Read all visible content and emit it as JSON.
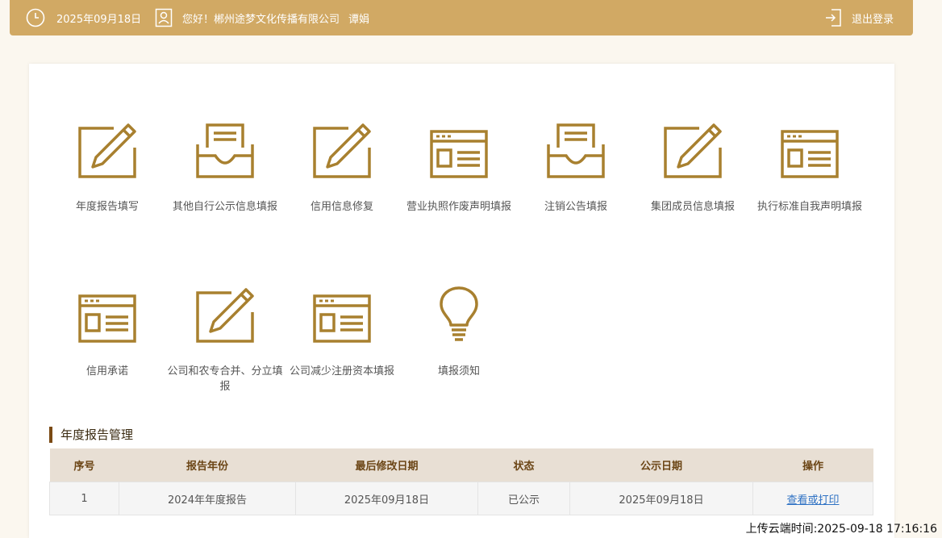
{
  "header": {
    "date": "2025年09月18日",
    "greeting": "您好！郴州途梦文化传播有限公司",
    "user": "谭娟",
    "logout": "退出登录",
    "clock_icon": "clock-icon",
    "user_icon": "user-card-icon",
    "logout_icon": "logout-icon"
  },
  "tiles": [
    {
      "label": "年度报告填写",
      "icon": "edit-pencil-icon"
    },
    {
      "label": "其他自行公示信息填报",
      "icon": "inbox-tray-icon"
    },
    {
      "label": "信用信息修复",
      "icon": "edit-pencil-icon"
    },
    {
      "label": "营业执照作废声明填报",
      "icon": "web-form-icon"
    },
    {
      "label": "注销公告填报",
      "icon": "inbox-tray-icon"
    },
    {
      "label": "集团成员信息填报",
      "icon": "edit-pencil-icon"
    },
    {
      "label": "执行标准自我声明填报",
      "icon": "web-form-icon"
    },
    {
      "label": "信用承诺",
      "icon": "web-form-icon"
    },
    {
      "label": "公司和农专合并、分立填报",
      "icon": "edit-pencil-icon"
    },
    {
      "label": "公司减少注册资本填报",
      "icon": "web-form-icon"
    },
    {
      "label": "填报须知",
      "icon": "lightbulb-icon"
    }
  ],
  "section": {
    "title": "年度报告管理"
  },
  "table": {
    "headers": [
      "序号",
      "报告年份",
      "最后修改日期",
      "状态",
      "公示日期",
      "操作"
    ],
    "rows": [
      {
        "no": "1",
        "year": "2024年年度报告",
        "modified": "2025年09月18日",
        "status": "已公示",
        "public_date": "2025年09月18日",
        "action": "查看或打印"
      }
    ]
  },
  "footer": {
    "upload_time": "上传云端时间:2025-09-18 17:16:16"
  },
  "colors": {
    "accent": "#d1a964",
    "icon": "#a8802f",
    "section_bar": "#7a4a14",
    "link": "#2f72c4"
  }
}
